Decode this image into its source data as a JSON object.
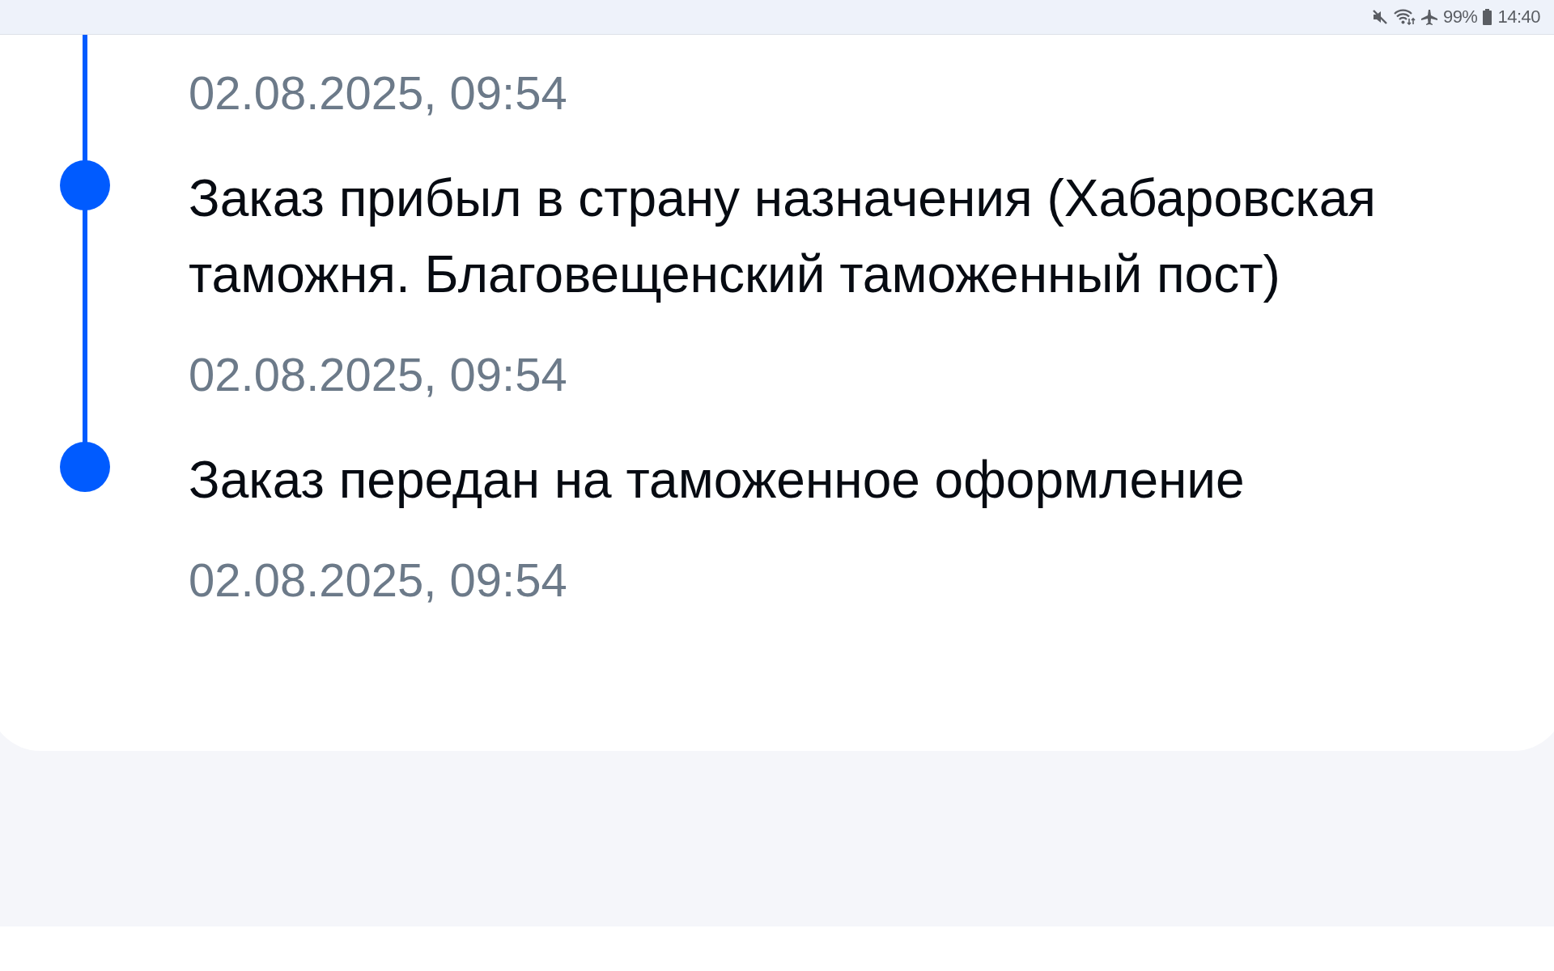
{
  "status_bar": {
    "battery": "99%",
    "time": "14:40"
  },
  "timeline": {
    "events": [
      {
        "time": "02.08.2025, 09:54"
      },
      {
        "title": "Заказ прибыл в страну назначения (Хабаровская таможня. Благовещенский таможенный пост)",
        "time": "02.08.2025, 09:54"
      },
      {
        "title": "Заказ передан на таможенное оформление",
        "time": "02.08.2025, 09:54"
      }
    ]
  }
}
